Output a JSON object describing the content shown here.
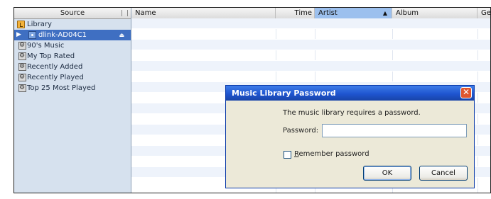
{
  "sidebar": {
    "header": "Source",
    "items": [
      {
        "label": "Library",
        "type": "library"
      },
      {
        "label": "dlink-AD04C1",
        "type": "share",
        "selected": true
      },
      {
        "label": "90's Music",
        "type": "smart"
      },
      {
        "label": "My Top Rated",
        "type": "smart"
      },
      {
        "label": "Recently Added",
        "type": "smart"
      },
      {
        "label": "Recently Played",
        "type": "smart"
      },
      {
        "label": "Top 25 Most Played",
        "type": "smart"
      }
    ]
  },
  "columns": {
    "name": "Name",
    "time": "Time",
    "artist": "Artist",
    "album": "Album",
    "genre": "Genr"
  },
  "dialog": {
    "title": "Music Library Password",
    "message": "The music library requires a password.",
    "password_label": "Password:",
    "password_value": "",
    "remember_label_rest": "emember password",
    "remember_accel": "R",
    "remember_checked": false,
    "ok_label": "OK",
    "cancel_label": "Cancel"
  },
  "icons": {
    "library": "music-note-icon",
    "share": "shared-library-icon",
    "smart": "smart-playlist-icon",
    "sort": "sort-ascending-icon",
    "close": "close-icon",
    "eject": "eject-icon"
  }
}
